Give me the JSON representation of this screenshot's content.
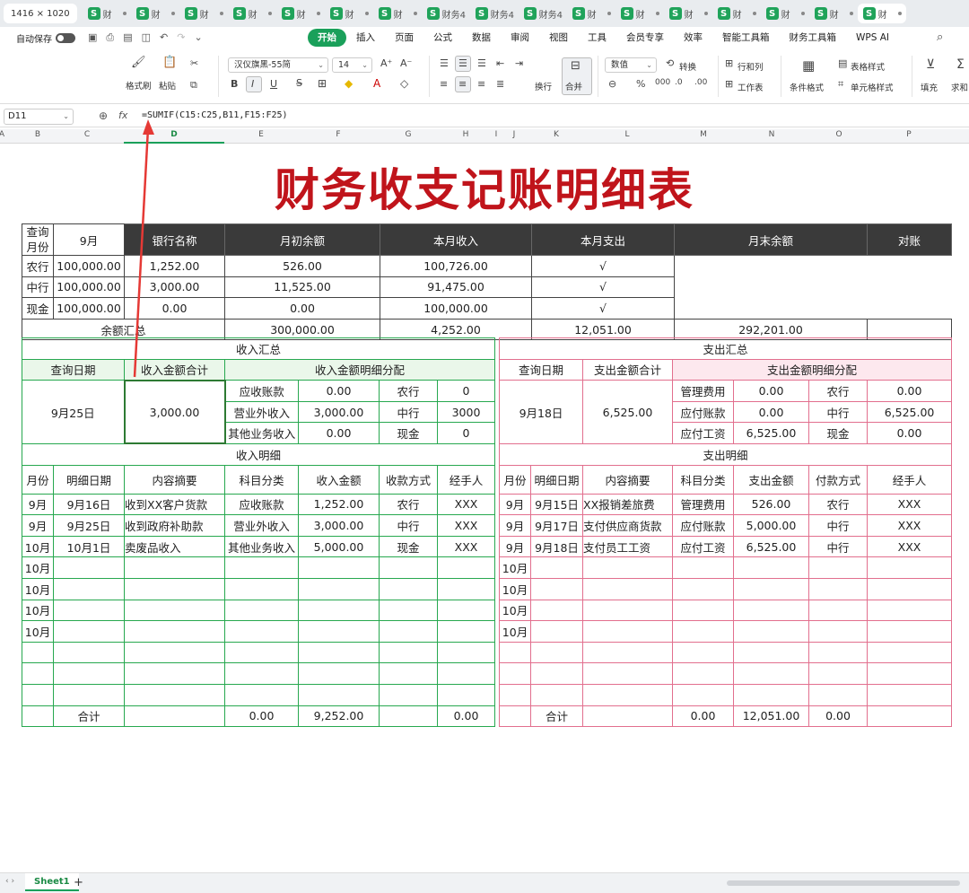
{
  "tabbar": {
    "resolution": "1416 × 1020",
    "tabs": [
      "财",
      "财",
      "财",
      "财",
      "财",
      "财",
      "财",
      "财务4",
      "财务4",
      "财务4",
      "财",
      "财",
      "财",
      "财",
      "财",
      "财",
      "财"
    ]
  },
  "menubar": {
    "autosave_label": "自动保存",
    "menus": [
      "开始",
      "插入",
      "页面",
      "公式",
      "数据",
      "审阅",
      "视图",
      "工具",
      "会员专享",
      "效率",
      "智能工具箱",
      "财务工具箱",
      "WPS AI"
    ]
  },
  "ribbon": {
    "format_painter": "格式刷",
    "paste": "粘贴",
    "font_name": "汉仪旗黑-55简",
    "font_size": "14",
    "wrap": "换行",
    "merge": "合并",
    "number_format": "数值",
    "convert": "转换",
    "rows_cols": "行和列",
    "table_style": "表格样式",
    "worksheet": "工作表",
    "cond_format": "条件格式",
    "cell_style": "单元格样式",
    "fill": "填充",
    "sum": "求和"
  },
  "formulabar": {
    "cell_ref": "D11",
    "fx": "fx",
    "formula": "=SUMIF(C15:C25,B11,F15:F25)"
  },
  "columns": [
    "A",
    "B",
    "C",
    "D",
    "E",
    "F",
    "G",
    "H",
    "I",
    "J",
    "K",
    "L",
    "M",
    "N",
    "O",
    "P"
  ],
  "title": "财务收支记账明细表",
  "top": {
    "query_month_label": "查询\n月份",
    "month": "9月",
    "headers": [
      "银行名称",
      "月初余额",
      "本月收入",
      "本月支出",
      "月末余额",
      "对账"
    ],
    "rows": [
      [
        "农行",
        "100,000.00",
        "1,252.00",
        "526.00",
        "100,726.00",
        "√"
      ],
      [
        "中行",
        "100,000.00",
        "3,000.00",
        "11,525.00",
        "91,475.00",
        "√"
      ],
      [
        "现金",
        "100,000.00",
        "0.00",
        "0.00",
        "100,000.00",
        "√"
      ]
    ],
    "total_label": "余额汇总",
    "totals": [
      "300,000.00",
      "4,252.00",
      "12,051.00",
      "292,201.00",
      ""
    ]
  },
  "income": {
    "summary_title": "收入汇总",
    "date_label": "查询日期",
    "total_label": "收入金额合计",
    "dist_label": "收入金额明细分配",
    "date": "9月25日",
    "total": "3,000.00",
    "dist": [
      [
        "应收账款",
        "0.00",
        "农行",
        "0"
      ],
      [
        "营业外收入",
        "3,000.00",
        "中行",
        "3000"
      ],
      [
        "其他业务收入",
        "0.00",
        "现金",
        "0"
      ]
    ],
    "detail_title": "收入明细",
    "detail_headers": [
      "月份",
      "明细日期",
      "内容摘要",
      "科目分类",
      "收入金额",
      "收款方式",
      "经手人"
    ],
    "rows": [
      [
        "9月",
        "9月16日",
        "收到XX客户货款",
        "应收账款",
        "1,252.00",
        "农行",
        "XXX"
      ],
      [
        "9月",
        "9月25日",
        "收到政府补助款",
        "营业外收入",
        "3,000.00",
        "中行",
        "XXX"
      ],
      [
        "10月",
        "10月1日",
        "卖废品收入",
        "其他业务收入",
        "5,000.00",
        "现金",
        "XXX"
      ],
      [
        "10月",
        "",
        "",
        "",
        "",
        "",
        ""
      ],
      [
        "10月",
        "",
        "",
        "",
        "",
        "",
        ""
      ],
      [
        "10月",
        "",
        "",
        "",
        "",
        "",
        ""
      ],
      [
        "10月",
        "",
        "",
        "",
        "",
        "",
        ""
      ],
      [
        "",
        "",
        "",
        "",
        "",
        "",
        ""
      ],
      [
        "",
        "",
        "",
        "",
        "",
        "",
        ""
      ],
      [
        "",
        "",
        "",
        "",
        "",
        "",
        ""
      ]
    ],
    "sum_label": "合计",
    "sums": [
      "0.00",
      "9,252.00",
      "0.00"
    ]
  },
  "expense": {
    "summary_title": "支出汇总",
    "date_label": "查询日期",
    "total_label": "支出金额合计",
    "dist_label": "支出金额明细分配",
    "date": "9月18日",
    "total": "6,525.00",
    "dist": [
      [
        "管理费用",
        "0.00",
        "农行",
        "0.00"
      ],
      [
        "应付账款",
        "0.00",
        "中行",
        "6,525.00"
      ],
      [
        "应付工资",
        "6,525.00",
        "现金",
        "0.00"
      ]
    ],
    "detail_title": "支出明细",
    "detail_headers": [
      "月份",
      "明细日期",
      "内容摘要",
      "科目分类",
      "支出金额",
      "付款方式",
      "经手人"
    ],
    "rows": [
      [
        "9月",
        "9月15日",
        "XX报销差旅费",
        "管理费用",
        "526.00",
        "农行",
        "XXX"
      ],
      [
        "9月",
        "9月17日",
        "支付供应商货款",
        "应付账款",
        "5,000.00",
        "中行",
        "XXX"
      ],
      [
        "9月",
        "9月18日",
        "支付员工工资",
        "应付工资",
        "6,525.00",
        "中行",
        "XXX"
      ],
      [
        "10月",
        "",
        "",
        "",
        "",
        "",
        ""
      ],
      [
        "10月",
        "",
        "",
        "",
        "",
        "",
        ""
      ],
      [
        "10月",
        "",
        "",
        "",
        "",
        "",
        ""
      ],
      [
        "10月",
        "",
        "",
        "",
        "",
        "",
        ""
      ],
      [
        "",
        "",
        "",
        "",
        "",
        "",
        ""
      ],
      [
        "",
        "",
        "",
        "",
        "",
        "",
        ""
      ],
      [
        "",
        "",
        "",
        "",
        "",
        "",
        ""
      ]
    ],
    "sum_label": "合计",
    "sums": [
      "0.00",
      "12,051.00",
      "0.00"
    ]
  },
  "statusbar": {
    "sheet": "Sheet1",
    "add": "+"
  }
}
